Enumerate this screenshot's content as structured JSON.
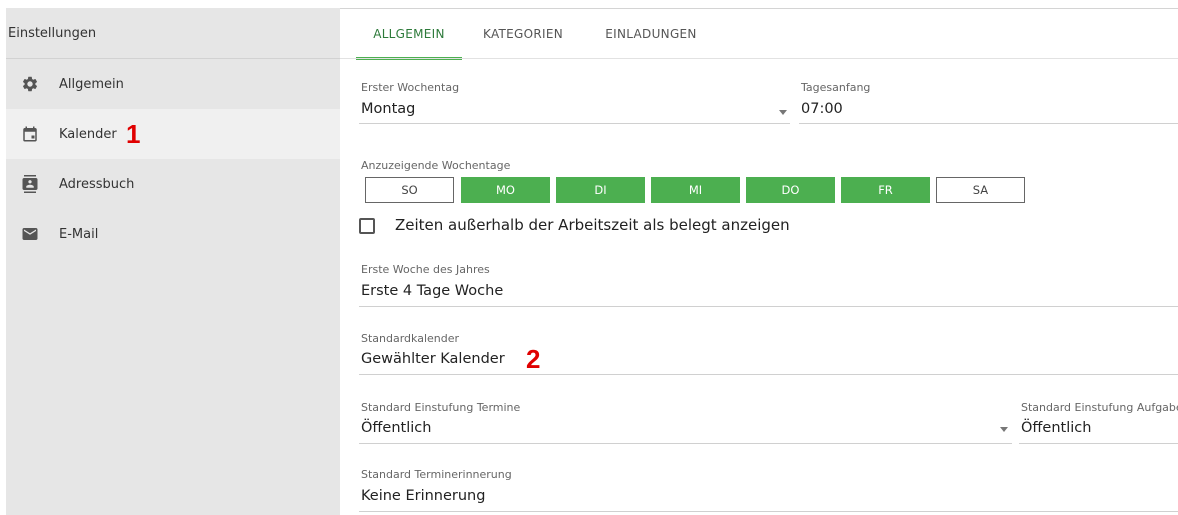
{
  "sidebar": {
    "title": "Einstellungen",
    "items": [
      {
        "label": "Allgemein",
        "icon": "gear-icon"
      },
      {
        "label": "Kalender",
        "icon": "calendar-icon"
      },
      {
        "label": "Adressbuch",
        "icon": "address-book-icon"
      },
      {
        "label": "E-Mail",
        "icon": "mail-icon"
      }
    ]
  },
  "annotations": {
    "one": "1",
    "two": "2"
  },
  "tabs": [
    "ALLGEMEIN",
    "KATEGORIEN",
    "EINLADUNGEN"
  ],
  "form": {
    "first_weekday": {
      "label": "Erster Wochentag",
      "value": "Montag"
    },
    "day_start": {
      "label": "Tagesanfang",
      "value": "07:00"
    },
    "weekdays": {
      "label": "Anzuzeigende Wochentage",
      "days": [
        {
          "label": "SO",
          "selected": false
        },
        {
          "label": "MO",
          "selected": true
        },
        {
          "label": "DI",
          "selected": true
        },
        {
          "label": "MI",
          "selected": true
        },
        {
          "label": "DO",
          "selected": true
        },
        {
          "label": "FR",
          "selected": true
        },
        {
          "label": "SA",
          "selected": false
        }
      ]
    },
    "busy_outside_hours": {
      "label": "Zeiten außerhalb der Arbeitszeit als belegt anzeigen",
      "checked": false
    },
    "first_week": {
      "label": "Erste Woche des Jahres",
      "value": "Erste 4 Tage Woche"
    },
    "default_calendar": {
      "label": "Standardkalender",
      "value": "Gewählter Kalender"
    },
    "appointment_classification": {
      "label": "Standard Einstufung Termine",
      "value": "Öffentlich"
    },
    "task_classification": {
      "label": "Standard Einstufung Aufgaben",
      "value": "Öffentlich"
    },
    "reminder": {
      "label": "Standard Terminerinnerung",
      "value": "Keine Erinnerung"
    }
  },
  "colors": {
    "accent": "#4caf50",
    "accent_text": "#2d7a3a",
    "annotation": "#e00000",
    "sidebar_bg": "#e6e6e6"
  }
}
